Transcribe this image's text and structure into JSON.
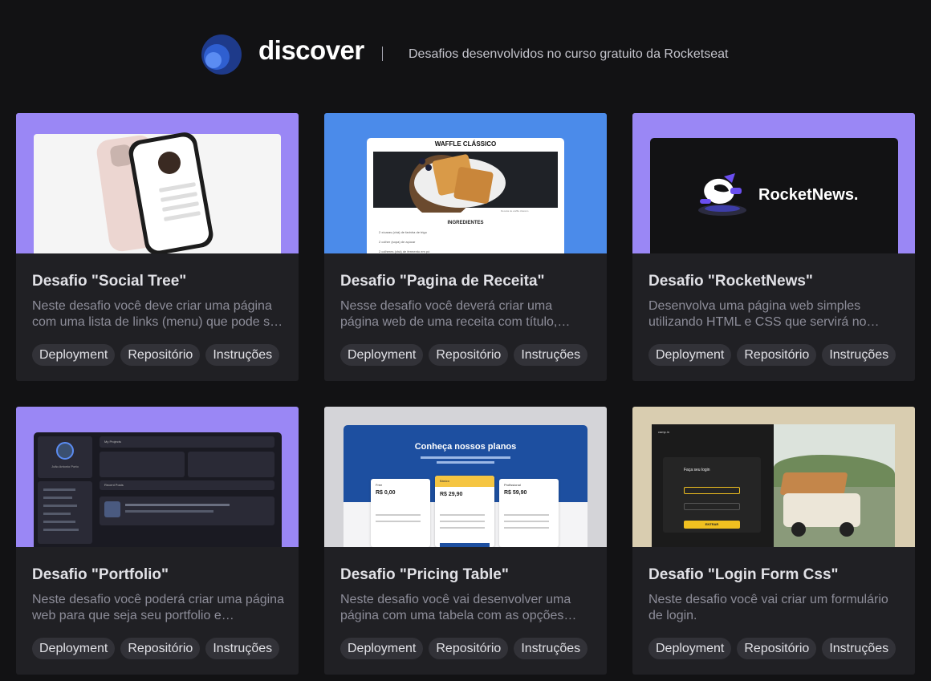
{
  "header": {
    "brand": "discover",
    "tagline": "Desafios desenvolvidos no curso gratuito da Rocketseat"
  },
  "colors": {
    "background": "#121214",
    "card": "#202024",
    "tag": "#323238",
    "purple": "#8257e5",
    "lavender": "#9a87f5",
    "blue_accent": "#4b8bea"
  },
  "cards": [
    {
      "title": "Desafio \"Social Tree\"",
      "description": "Neste desafio você deve criar uma página com uma lista de links (menu) que pode s…",
      "tags": [
        "Deployment",
        "Repositório",
        "Instruções"
      ]
    },
    {
      "title": "Desafio \"Pagina de Receita\"",
      "description": "Nesse desafio você deverá criar uma página web de uma receita com título,…",
      "tags": [
        "Deployment",
        "Repositório",
        "Instruções"
      ],
      "thumb": {
        "heading": "WAFFLE CLÁSSICO",
        "caption": "Receita de waffle clássico",
        "section": "INGREDIENTES",
        "items": [
          "2 xícaras (chá) de farinha de trigo",
          "2 colher (sopa) de açúcar",
          "2 colheres (chá) de fermento em pó"
        ]
      }
    },
    {
      "title": "Desafio \"RocketNews\"",
      "description": "Desenvolva uma página web simples utilizando HTML e CSS que servirá no…",
      "tags": [
        "Deployment",
        "Repositório",
        "Instruções"
      ],
      "thumb": {
        "logo_text": "RocketNews."
      }
    },
    {
      "title": "Desafio \"Portfolio\"",
      "description": "Neste desafio você poderá criar uma página web para que seja seu portfolio e…",
      "tags": [
        "Deployment",
        "Repositório",
        "Instruções"
      ],
      "thumb": {
        "name": "João Antonio Porto",
        "section1": "My Projects",
        "section2": "Recent Posts"
      }
    },
    {
      "title": "Desafio \"Pricing Table\"",
      "description": "Neste desafio você vai desenvolver uma página com uma tabela com as opções de…",
      "tags": [
        "Deployment",
        "Repositório",
        "Instruções"
      ],
      "thumb": {
        "heading": "Conheça nossos planos",
        "plans": [
          {
            "name": "Free",
            "price": "R$ 0,00"
          },
          {
            "name": "Básico",
            "price": "R$ 29,90"
          },
          {
            "name": "Profissional",
            "price": "R$ 59,90"
          }
        ]
      }
    },
    {
      "title": "Desafio \"Login Form Css\"",
      "description": "Neste desafio você vai criar um formulário de login.",
      "tags": [
        "Deployment",
        "Repositório",
        "Instruções"
      ],
      "thumb": {
        "brand": "camp.in",
        "heading": "Faça seu login",
        "button": "ENTRAR"
      }
    }
  ]
}
